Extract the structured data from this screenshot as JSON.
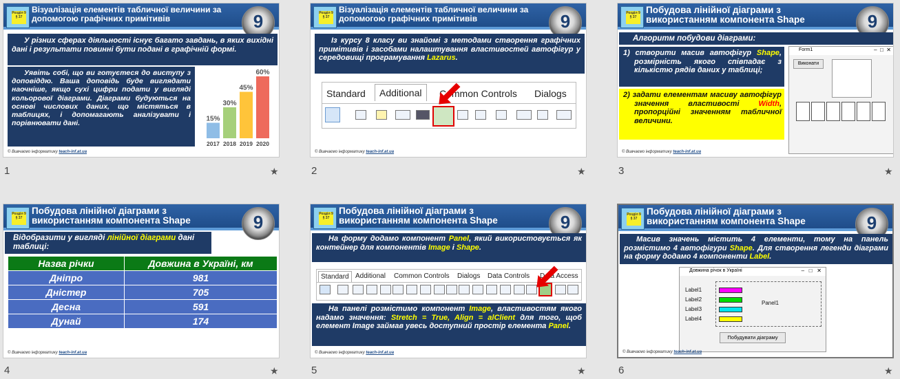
{
  "footer": {
    "prefix": "© Вивчаємо інформатику",
    "link": "teach-inf.at.ua"
  },
  "badge_text": "Розділ 9 § 37",
  "logo_text": "9",
  "star": "★",
  "slides": [
    {
      "num": "1",
      "title": "Візуалізація елементів табличної величини за допомогою графічних примітивів",
      "intro": "У різних сферах діяльності існує багато завдань, в яких вихідні дані і результати повинні бути подані в графічній формі.",
      "body": "Уявіть собі, що ви готуєтеся до виступу з доповіддю. Ваша доповідь буде виглядати наочніше, якщо сухі цифри подати у вигляді кольорової діаграми. Діаграми будуються на основі числових даних, що містяться в таблицях, і допомагають аналізувати і порівнювати дані."
    },
    {
      "num": "2",
      "title": "Візуалізація елементів табличної величини за допомогою графічних примітивів",
      "text_a": "Із курсу 8 класу ви знайомі з методами створення графічних примітивів і засобами налаштування властивостей автофігур у середовищі програмування ",
      "text_hl": "Lazarus",
      "text_b": ".",
      "tabs": [
        "Standard",
        "Additional",
        "Common Controls",
        "Dialogs"
      ]
    },
    {
      "num": "3",
      "title": "Побудова лінійної діаграми з використанням компонента Shape",
      "algo": "Алгоритм побудови діаграми:",
      "step1_num": "1)",
      "step1_a": "створити масив автофігур ",
      "step1_hl": "Shape",
      "step1_b": ", розмірність якого співпадає з кількістю рядів даних у таблиці;",
      "step2_num": "2)",
      "step2_a": "задати елементам масиву автофігур значення властивості ",
      "step2_red": "Width",
      "step2_b": ", пропорційні значенням табличної величини.",
      "form_title": "Form1",
      "form_button": "Виконати"
    },
    {
      "num": "4",
      "title": "Побудова лінійної діаграми з використанням компонента Shape",
      "intro_a": "Відобразити у вигляді ",
      "intro_hl": "лінійної діаграми",
      "intro_b": " дані таблиці:",
      "headers": [
        "Назва річки",
        "Довжина в Україні, км"
      ],
      "rows": [
        [
          "Дніпро",
          "981"
        ],
        [
          "Дністер",
          "705"
        ],
        [
          "Десна",
          "591"
        ],
        [
          "Дунай",
          "174"
        ]
      ]
    },
    {
      "num": "5",
      "title": "Побудова лінійної діаграми з використанням компонента Shape",
      "p1_a": "На форму додамо компонент ",
      "p1_hl1": "Panel",
      "p1_b": ", який використовується як контейнер для компонентів ",
      "p1_hl2": "Image",
      "p1_c": " і ",
      "p1_hl3": "Shape",
      "p1_d": ".",
      "tabs": [
        "Standard",
        "Additional",
        "Common Controls",
        "Dialogs",
        "Data Controls",
        "Data Access"
      ],
      "p2_a": "На панелі розмістимо компонент ",
      "p2_hl1": "Image",
      "p2_b": ", властивостям якого надамо значення: ",
      "p2_hl2": "Stretch = True, Align = alClient",
      "p2_c": " для того, щоб елемент Image займав увесь доступний простір елемента ",
      "p2_hl3": "Panel",
      "p2_d": "."
    },
    {
      "num": "6",
      "title": "Побудова лінійної діаграми з використанням компонента Shape",
      "p_a": "Масив значень містить 4 елементи, тому на панель розмістимо 4 автофігури ",
      "p_hl1": "Shape",
      "p_b": ". Для створення легенди діаграми на форму додамо 4 компоненти ",
      "p_hl2": "Label",
      "p_c": ".",
      "form_title": "Довжина річок в Україні",
      "labels": [
        "Label1",
        "Label2",
        "Label3",
        "Label4"
      ],
      "panel_label": "Panel1",
      "button": "Побудувати діаграму",
      "bar_colors": [
        "#ff00ff",
        "#00dd00",
        "#00e5ee",
        "#ffff00"
      ]
    }
  ],
  "chart_data": {
    "type": "bar",
    "categories": [
      "2017",
      "2018",
      "2019",
      "2020"
    ],
    "values": [
      15,
      30,
      45,
      60
    ],
    "data_labels": [
      "15%",
      "30%",
      "45%",
      "60%"
    ],
    "colors": [
      "#8fbde6",
      "#a6d07a",
      "#ffc43a",
      "#ee6a5c"
    ],
    "title": "",
    "xlabel": "",
    "ylabel": "",
    "ylim": [
      0,
      60
    ]
  }
}
